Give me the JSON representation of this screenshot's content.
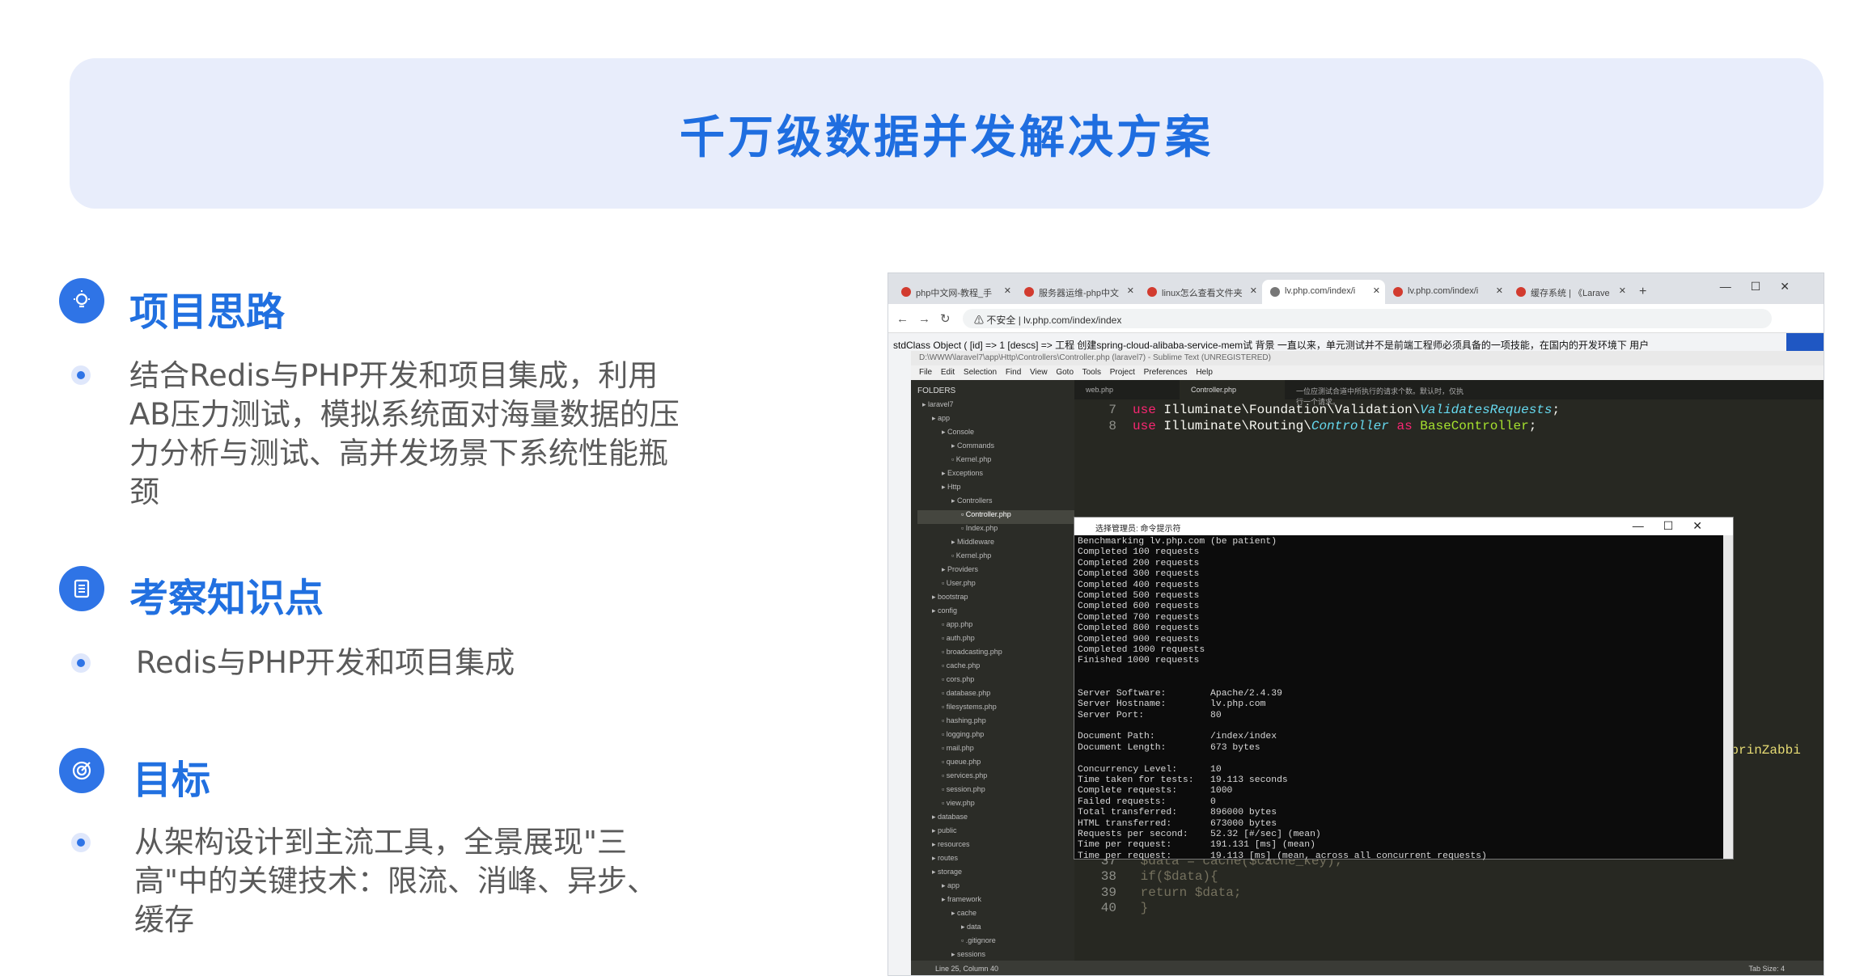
{
  "title": "千万级数据并发解决方案",
  "sections": [
    {
      "title": "项目思路",
      "icon": "lightbulb-icon",
      "text": "结合Redis与PHP开发和项目集成，利用AB压力测试，模拟系统面对海量数据的压力分析与测试、高并发场景下系统性能瓶颈"
    },
    {
      "title": "考察知识点",
      "icon": "document-icon",
      "text": "Redis与PHP开发和项目集成"
    },
    {
      "title": "目标",
      "icon": "target-icon",
      "text": "从架构设计到主流工具，全景展现\"三高\"中的关键技术：限流、消峰、异步、缓存"
    }
  ],
  "browser": {
    "tabs": [
      "php中文网-教程_手",
      "服务器运维-php中文",
      "linux怎么查看文件夹",
      "lv.php.com/index/i",
      "lv.php.com/index/i",
      "缓存系统 | 《Larave"
    ],
    "url": "lv.php.com/index/index",
    "insecure": "不安全",
    "output": "stdClass Object ( [id] => 1 [descs] => 工程 创建spring-cloud-alibaba-service-mem试 背景 一直以来，单元测试并不是前端工程师必须具备的一项技能，在国内的开发环境下 用户"
  },
  "sublime": {
    "title": "D:\\WWW\\laravel7\\app\\Http\\Controllers\\Controller.php (laravel7) - Sublime Text (UNREGISTERED)",
    "menu": "File Edit Selection Find View Goto Tools Project Preferences Help",
    "tabs": [
      "web.php",
      "Controller.php",
      "一位应测试合道中所执行的请求个数。默认时，仅执行一个请求。"
    ],
    "folders_label": "FOLDERS",
    "tree": [
      "laravel7",
      "app",
      "Console",
      "Commands",
      "Kernel.php",
      "Exceptions",
      "Http",
      "Controllers",
      "Controller.php",
      "Index.php",
      "Middleware",
      "Kernel.php",
      "Providers",
      "User.php",
      "bootstrap",
      "config",
      "app.php",
      "auth.php",
      "broadcasting.php",
      "cache.php",
      "cors.php",
      "database.php",
      "filesystems.php",
      "hashing.php",
      "logging.php",
      "mail.php",
      "queue.php",
      "services.php",
      "session.php",
      "view.php",
      "database",
      "public",
      "resources",
      "routes",
      "storage",
      "app",
      "framework",
      "cache",
      "data",
      ".gitignore",
      "sessions"
    ],
    "status": "Line 25, Column 40",
    "tabsize": "Tab Size: 4"
  },
  "cmd": {
    "title": "选择管理员: 命令提示符",
    "output": "Benchmarking lv.php.com (be patient)\nCompleted 100 requests\nCompleted 200 requests\nCompleted 300 requests\nCompleted 400 requests\nCompleted 500 requests\nCompleted 600 requests\nCompleted 700 requests\nCompleted 800 requests\nCompleted 900 requests\nCompleted 1000 requests\nFinished 1000 requests\n\n\nServer Software:        Apache/2.4.39\nServer Hostname:        lv.php.com\nServer Port:            80\n\nDocument Path:          /index/index\nDocument Length:        673 bytes\n\nConcurrency Level:      10\nTime taken for tests:   19.113 seconds\nComplete requests:      1000\nFailed requests:        0\nTotal transferred:      896000 bytes\nHTML transferred:       673000 bytes\nRequests per second:    52.32 [#/sec] (mean)\nTime per request:       191.131 [ms] (mean)\nTime per request:       19.113 [ms] (mean, across all concurrent requests)"
  }
}
